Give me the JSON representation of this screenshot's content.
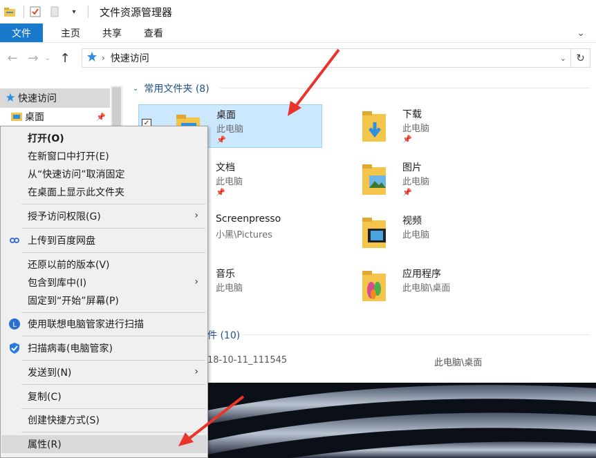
{
  "window": {
    "title": "文件资源管理器"
  },
  "ribbon": {
    "tabs": [
      "文件",
      "主页",
      "共享",
      "查看"
    ]
  },
  "address": {
    "crumb": "快速访问"
  },
  "sidebar": {
    "items": [
      {
        "label": "快速访问"
      },
      {
        "label": "桌面"
      }
    ]
  },
  "main": {
    "frequent_header": "常用文件夹 (8)",
    "recent_header_fragment": "件 (10)",
    "folders": [
      {
        "name": "桌面",
        "location": "此电脑",
        "pinned": true,
        "selected": true
      },
      {
        "name": "下载",
        "location": "此电脑",
        "pinned": true
      },
      {
        "name": "文档",
        "location": "此电脑",
        "pinned": true
      },
      {
        "name": "图片",
        "location": "此电脑",
        "pinned": true
      },
      {
        "name": "Screenpresso",
        "location": "小黑\\Pictures",
        "pinned": false
      },
      {
        "name": "视频",
        "location": "此电脑",
        "pinned": false
      },
      {
        "name": "音乐",
        "location": "此电脑",
        "pinned": false
      },
      {
        "name": "应用程序",
        "location": "此电脑\\桌面",
        "pinned": false
      }
    ],
    "recent_partial": {
      "name_fragment": "18-10-11_111545",
      "location_fragment": "此电脑\\桌面"
    }
  },
  "context_menu": {
    "items": [
      {
        "label": "打开(O)",
        "bold": true
      },
      {
        "label": "在新窗口中打开(E)"
      },
      {
        "label": "从“快速访问”取消固定"
      },
      {
        "label": "在桌面上显示此文件夹"
      },
      {
        "label": "授予访问权限(G)",
        "submenu": true
      },
      {
        "label": "上传到百度网盘",
        "icon": "baidu-netdisk-icon"
      },
      {
        "label": "还原以前的版本(V)"
      },
      {
        "label": "包含到库中(I)",
        "submenu": true
      },
      {
        "label": "固定到“开始”屏幕(P)"
      },
      {
        "label": "使用联想电脑管家进行扫描",
        "icon": "lenovo-manager-icon"
      },
      {
        "label": "扫描病毒(电脑管家)",
        "icon": "tencent-manager-shield-icon"
      },
      {
        "label": "发送到(N)",
        "submenu": true
      },
      {
        "label": "复制(C)"
      },
      {
        "label": "创建快捷方式(S)"
      },
      {
        "label": "属性(R)",
        "highlighted": true
      }
    ]
  },
  "annotation_color": "#e8342a"
}
